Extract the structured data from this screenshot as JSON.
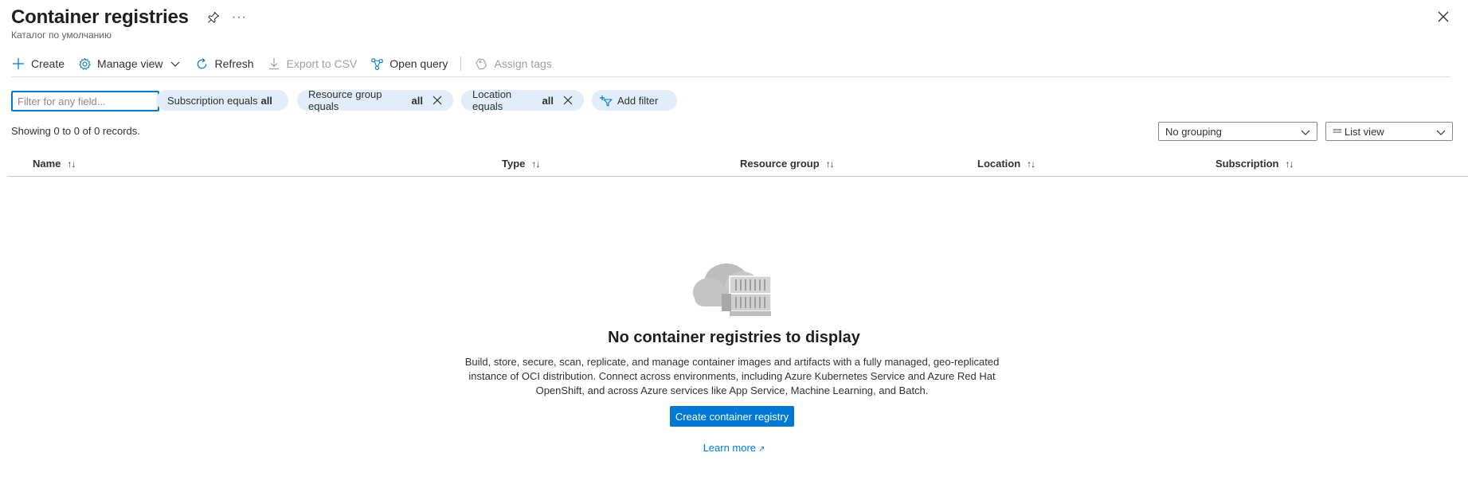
{
  "header": {
    "title": "Container registries",
    "subtitle": "Каталог по умолчанию",
    "more": "···"
  },
  "toolbar": {
    "create": "Create",
    "manage_view": "Manage view",
    "refresh": "Refresh",
    "export_csv": "Export to CSV",
    "open_query": "Open query",
    "assign_tags": "Assign tags"
  },
  "filters": {
    "placeholder": "Filter for any field...",
    "subscription": {
      "label": "Subscription equals",
      "value": "all"
    },
    "resource_group": {
      "label": "Resource group equals",
      "value": "all"
    },
    "location": {
      "label": "Location equals",
      "value": "all"
    },
    "add_filter": "Add filter"
  },
  "records": "Showing 0 to 0 of 0 records.",
  "grouping": {
    "selected": "No grouping"
  },
  "view": {
    "selected": "List view",
    "icon": "≡≡"
  },
  "table": {
    "columns": [
      {
        "label": "Name",
        "sort": "↑↓"
      },
      {
        "label": "Type",
        "sort": "↑↓"
      },
      {
        "label": "Resource group",
        "sort": "↑↓"
      },
      {
        "label": "Location",
        "sort": "↑↓"
      },
      {
        "label": "Subscription",
        "sort": "↑↓"
      }
    ]
  },
  "empty_state": {
    "title": "No container registries to display",
    "description": "Build, store, secure, scan, replicate, and manage container images and artifacts with a fully managed, geo-replicated instance of OCI distribution. Connect across environments, including Azure Kubernetes Service and Azure Red Hat OpenShift, and across Azure services like App Service, Machine Learning, and Batch.",
    "button": "Create container registry",
    "learn_more": "Learn more"
  },
  "colors": {
    "accent": "#0078d4",
    "pill_bg": "#e1edf8",
    "text": "#323130"
  }
}
